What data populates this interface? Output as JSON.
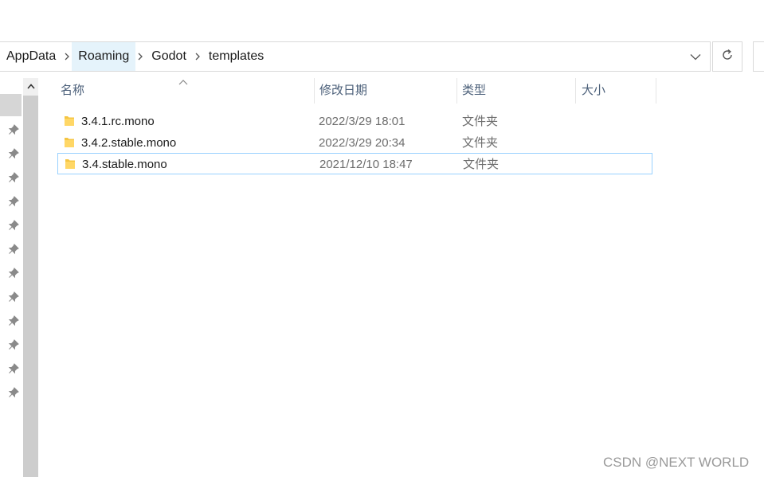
{
  "breadcrumb": {
    "items": [
      "AppData",
      "Roaming",
      "Godot",
      "templates"
    ]
  },
  "icons": {
    "separator": "chevron-right-icon",
    "dropdown": "chevron-down-icon",
    "refresh": "refresh-icon",
    "pin": "pin-icon",
    "folder": "folder-icon"
  },
  "columns": {
    "name": "名称",
    "modified": "修改日期",
    "type": "类型",
    "size": "大小"
  },
  "files": [
    {
      "name": "3.4.1.rc.mono",
      "modified": "2022/3/29 18:01",
      "type": "文件夹",
      "selected": false
    },
    {
      "name": "3.4.2.stable.mono",
      "modified": "2022/3/29 20:34",
      "type": "文件夹",
      "selected": false
    },
    {
      "name": "3.4.stable.mono",
      "modified": "2021/12/10 18:47",
      "type": "文件夹",
      "selected": true
    }
  ],
  "watermark": "CSDN @NEXT WORLD",
  "colors": {
    "selection_border": "#99d1ff",
    "hover_crumb": "#e5f3fb",
    "folder": "#f5c542"
  }
}
